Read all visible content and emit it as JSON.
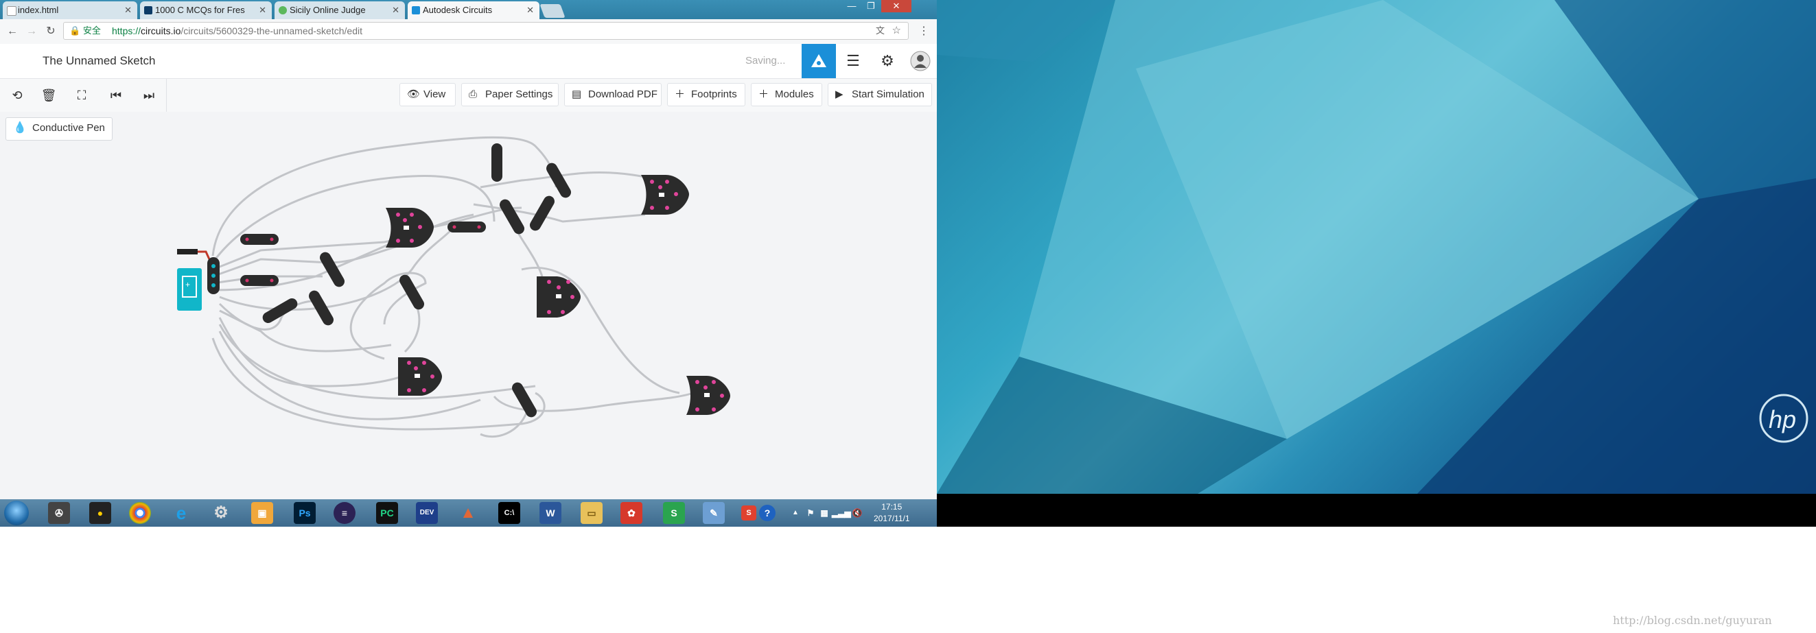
{
  "browser": {
    "tabs": [
      {
        "label": "index.html",
        "favicon": "document-icon",
        "color": "#ffffff"
      },
      {
        "label": "1000 C MCQs for Fres",
        "favicon": "sanfoundry-icon",
        "color": "#0d3b66"
      },
      {
        "label": "Sicily Online Judge",
        "favicon": "judge-check-icon",
        "color": "#5cb85c"
      },
      {
        "label": "Autodesk Circuits",
        "favicon": "autodesk-icon",
        "color": "#1b8fd8"
      }
    ],
    "secure_label": "安全",
    "url_prefix": "https://",
    "url_host": "circuits.io",
    "url_path": "/circuits/5600329-the-unnamed-sketch/edit"
  },
  "app": {
    "title": "The Unnamed Sketch",
    "status": "Saving...",
    "accent_color": "#1b8fd8"
  },
  "toolbar": {
    "buttons": [
      {
        "label": "View",
        "icon": "eye-icon"
      },
      {
        "label": "Paper Settings",
        "icon": "printer-icon"
      },
      {
        "label": "Download PDF",
        "icon": "pdf-icon"
      },
      {
        "label": "Footprints",
        "icon": "plus-icon"
      },
      {
        "label": "Modules",
        "icon": "plus-icon"
      },
      {
        "label": "Start Simulation",
        "icon": "play-icon"
      }
    ]
  },
  "canvas": {
    "pen_button": "Conductive Pen"
  },
  "taskbar": {
    "time": "17:15",
    "date": "2017/11/1"
  },
  "watermark": "http://blog.csdn.net/guyuran"
}
